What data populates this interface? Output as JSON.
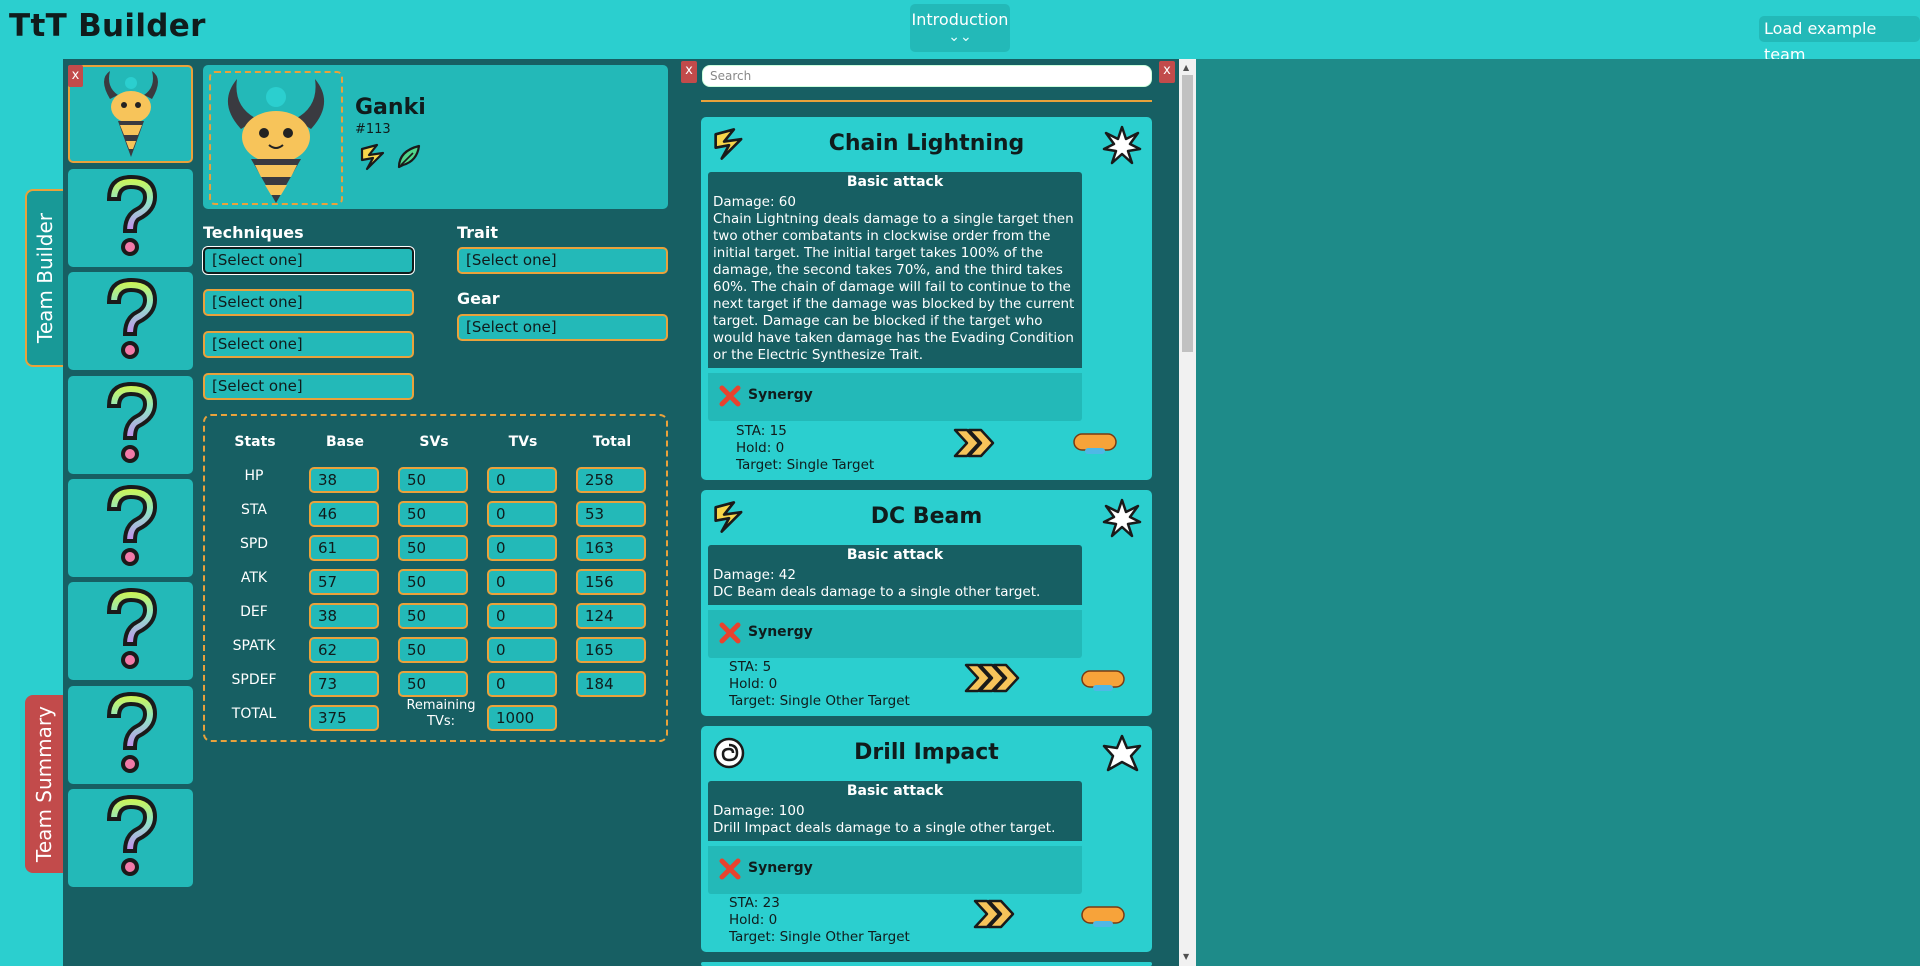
{
  "header": {
    "title": "TtT Builder",
    "intro_label": "Introduction",
    "intro_chevron": "⌄⌄",
    "load_example_label": "Load example team"
  },
  "side_tabs": {
    "builder": "Team Builder",
    "summary": "Team Summary"
  },
  "slots": {
    "close_label": "x"
  },
  "monster": {
    "name": "Ganki",
    "number": "#113"
  },
  "labels": {
    "techniques": "Techniques",
    "trait": "Trait",
    "gear": "Gear"
  },
  "selects": {
    "tech1": "[Select one]",
    "tech2": "[Select one]",
    "tech3": "[Select one]",
    "tech4": "[Select one]",
    "trait": "[Select one]",
    "gear": "[Select one]"
  },
  "stats": {
    "headers": [
      "Stats",
      "Base",
      "SVs",
      "TVs",
      "Total"
    ],
    "rows": [
      {
        "name": "HP",
        "base": "38",
        "sv": "50",
        "tv": "0",
        "total": "258"
      },
      {
        "name": "STA",
        "base": "46",
        "sv": "50",
        "tv": "0",
        "total": "53"
      },
      {
        "name": "SPD",
        "base": "61",
        "sv": "50",
        "tv": "0",
        "total": "163"
      },
      {
        "name": "ATK",
        "base": "57",
        "sv": "50",
        "tv": "0",
        "total": "156"
      },
      {
        "name": "DEF",
        "base": "38",
        "sv": "50",
        "tv": "0",
        "total": "124"
      },
      {
        "name": "SPATK",
        "base": "62",
        "sv": "50",
        "tv": "0",
        "total": "165"
      },
      {
        "name": "SPDEF",
        "base": "73",
        "sv": "50",
        "tv": "0",
        "total": "184"
      }
    ],
    "total_label": "TOTAL",
    "total_base": "375",
    "remaining_label": "Remaining TVs:",
    "remaining_value": "1000"
  },
  "close_label": "x",
  "search": {
    "placeholder": "Search"
  },
  "techniques": [
    {
      "name": "Chain Lightning",
      "category": "Basic attack",
      "damage": "Damage: 60",
      "description": "Chain Lightning deals damage to a single target then two other combatants in clockwise order from the initial target. The initial target takes 100% of the damage, the second takes 70%, and the third takes 60%. The chain of damage will fail to continue to the next target if the damage was blocked by the current target. Damage can be blocked if the target who would have taken damage has the Evading Condition or the Electric Synthesize Trait.",
      "synergy": "Synergy",
      "sta": "STA: 15",
      "hold": "Hold: 0",
      "target": "Target: Single Target"
    },
    {
      "name": "DC Beam",
      "category": "Basic attack",
      "damage": "Damage: 42",
      "description": "DC Beam deals damage to a single other target.",
      "synergy": "Synergy",
      "sta": "STA: 5",
      "hold": "Hold: 0",
      "target": "Target: Single Other Target"
    },
    {
      "name": "Drill Impact",
      "category": "Basic attack",
      "damage": "Damage: 100",
      "description": "Drill Impact deals damage to a single other target.",
      "synergy": "Synergy",
      "sta": "STA: 23",
      "hold": "Hold: 0",
      "target": "Target: Single Other Target"
    }
  ],
  "colors": {
    "background": "#2bcfcf",
    "panel": "#175f63",
    "accent": "#e9a23b",
    "close": "#c24b4b"
  },
  "icons": {
    "electric": "electric-type-icon",
    "wind": "wind-type-icon",
    "physical": "physical-class-icon",
    "special": "special-class-icon",
    "synergy_none": "synergy-x-icon"
  }
}
